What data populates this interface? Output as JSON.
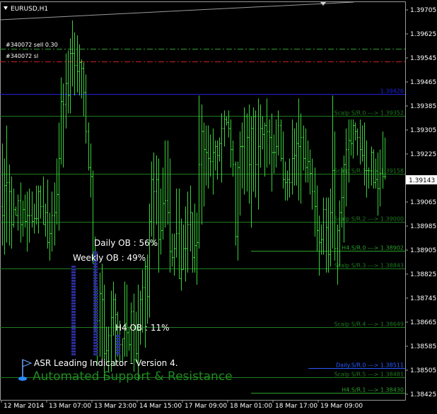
{
  "chart_data": {
    "type": "candlestick",
    "symbol_label": "EURUSD,H1",
    "y_ticks": [
      "1.39705",
      "1.39625",
      "1.39545",
      "1.39465",
      "1.39385",
      "1.39305",
      "1.39225",
      "1.39145",
      "1.39065",
      "1.38985",
      "1.38905",
      "1.38825",
      "1.38745",
      "1.38665",
      "1.38585",
      "1.38505",
      "1.38425"
    ],
    "y_range": [
      1.384,
      1.3974
    ],
    "x_ticks": [
      "12 Mar 2014",
      "13 Mar 07:00",
      "13 Mar 23:00",
      "14 Mar 15:00",
      "17 Mar 09:00",
      "18 Mar 01:00",
      "18 Mar 17:00",
      "19 Mar 09:00"
    ],
    "current_price": "1.39143",
    "levels": [
      {
        "label": "",
        "price": 1.39575,
        "color": "#2e9e2e",
        "style": "dashdot"
      },
      {
        "label": "",
        "price": 1.39534,
        "color": "#cc2222",
        "style": "dashdot"
      },
      {
        "label": "1.39426",
        "price": 1.39426,
        "color": "#1e22dd",
        "style": "solid"
      },
      {
        "label": "Scalp S/R.0 ---> 1.39352",
        "price": 1.39352,
        "color": "#1f7a1f",
        "style": "solid"
      },
      {
        "label": "Scalp S/R.1 ---> 1.39158",
        "price": 1.39158,
        "color": "#1f7a1f",
        "style": "solid"
      },
      {
        "label": "Scalp S/R.2 ---> 1.39000",
        "price": 1.39,
        "color": "#1f7a1f",
        "style": "solid"
      },
      {
        "label": "H4.S/R.0 ---> 1.38902",
        "price": 1.38902,
        "color": "#2aa02a",
        "style": "solid"
      },
      {
        "label": "Scalp S/R.3 ---> 1.38843",
        "price": 1.38843,
        "color": "#1f7a1f",
        "style": "solid"
      },
      {
        "label": "Scalp S/R.4 ---> 1.38649",
        "price": 1.38649,
        "color": "#1f7a1f",
        "style": "solid"
      },
      {
        "label": "Daily.S/R.0 ---> 1.38511",
        "price": 1.38511,
        "color": "#2a5bff",
        "style": "solid"
      },
      {
        "label": "Scalp S/R.5 ---> 1.38481",
        "price": 1.38481,
        "color": "#1f7a1f",
        "style": "solid"
      },
      {
        "label": "H4.S/R.1 ---> 1.38430",
        "price": 1.3843,
        "color": "#2aa02a",
        "style": "solid"
      }
    ],
    "orders": [
      "#340072 sell 0.30",
      "#340072 sl"
    ],
    "ob_labels": [
      {
        "text": "Daily OB : 56%",
        "value": 56
      },
      {
        "text": "Weekly OB : 49%",
        "value": 49
      },
      {
        "text": "H4 OB : 11%",
        "value": 11
      }
    ],
    "footer": {
      "line1": "ASR Leading Indicator - Version 4.",
      "line2": "Automated Support & Resistance"
    },
    "bars": [
      [
        1.3905,
        1.3926,
        1.3892,
        1.3902
      ],
      [
        1.3902,
        1.3921,
        1.3889,
        1.3912
      ],
      [
        1.3912,
        1.3932,
        1.3893,
        1.3913
      ],
      [
        1.3913,
        1.3919,
        1.3892,
        1.391
      ],
      [
        1.391,
        1.3915,
        1.3891,
        1.3899
      ],
      [
        1.3899,
        1.3911,
        1.3898,
        1.3904
      ],
      [
        1.3904,
        1.3905,
        1.3902,
        1.3902
      ],
      [
        1.3902,
        1.3909,
        1.3897,
        1.3907
      ],
      [
        1.3907,
        1.3913,
        1.3893,
        1.3899
      ],
      [
        1.3899,
        1.3907,
        1.3895,
        1.3904
      ],
      [
        1.3904,
        1.3909,
        1.3898,
        1.39
      ],
      [
        1.39,
        1.391,
        1.389,
        1.3902
      ],
      [
        1.3902,
        1.3911,
        1.3893,
        1.3902
      ],
      [
        1.3902,
        1.391,
        1.3898,
        1.39
      ],
      [
        1.39,
        1.3906,
        1.3896,
        1.3901
      ],
      [
        1.3901,
        1.3912,
        1.3899,
        1.3901
      ],
      [
        1.3901,
        1.3912,
        1.3896,
        1.391
      ],
      [
        1.391,
        1.3912,
        1.3901,
        1.3905
      ],
      [
        1.3905,
        1.3915,
        1.3899,
        1.3899
      ],
      [
        1.3899,
        1.3906,
        1.3895,
        1.3903
      ],
      [
        1.3903,
        1.3914,
        1.3891,
        1.3893
      ],
      [
        1.3893,
        1.3903,
        1.3887,
        1.3896
      ],
      [
        1.3896,
        1.391,
        1.389,
        1.3902
      ],
      [
        1.3902,
        1.3913,
        1.3892,
        1.3903
      ],
      [
        1.3903,
        1.3921,
        1.3899,
        1.3909
      ],
      [
        1.3909,
        1.3933,
        1.3897,
        1.3921
      ],
      [
        1.3921,
        1.3948,
        1.3919,
        1.394
      ],
      [
        1.394,
        1.3946,
        1.3918,
        1.3939
      ],
      [
        1.3939,
        1.3956,
        1.3931,
        1.3946
      ],
      [
        1.3946,
        1.3957,
        1.3936,
        1.3942
      ],
      [
        1.3942,
        1.3961,
        1.3936,
        1.3956
      ],
      [
        1.3956,
        1.3967,
        1.3945,
        1.3956
      ],
      [
        1.3956,
        1.3963,
        1.3942,
        1.3952
      ],
      [
        1.3952,
        1.3962,
        1.3943,
        1.395
      ],
      [
        1.395,
        1.3959,
        1.3942,
        1.3953
      ],
      [
        1.3953,
        1.3954,
        1.3941,
        1.3951
      ],
      [
        1.3951,
        1.3953,
        1.3935,
        1.3943
      ],
      [
        1.3943,
        1.3949,
        1.3926,
        1.393
      ],
      [
        1.393,
        1.3933,
        1.3917,
        1.3918
      ],
      [
        1.3918,
        1.3926,
        1.3908,
        1.3915
      ],
      [
        1.3915,
        1.3917,
        1.3886,
        1.3886
      ],
      [
        1.3886,
        1.3895,
        1.3863,
        1.387
      ],
      [
        1.387,
        1.3878,
        1.3852,
        1.3867
      ],
      [
        1.3867,
        1.3883,
        1.3855,
        1.3876
      ],
      [
        1.3876,
        1.3886,
        1.3854,
        1.3874
      ],
      [
        1.3874,
        1.3879,
        1.3847,
        1.3856
      ],
      [
        1.3856,
        1.3865,
        1.3852,
        1.3857
      ],
      [
        1.3857,
        1.3865,
        1.385,
        1.3862
      ],
      [
        1.3862,
        1.3877,
        1.385,
        1.3868
      ],
      [
        1.3868,
        1.388,
        1.3862,
        1.3874
      ],
      [
        1.3874,
        1.3876,
        1.3852,
        1.3869
      ],
      [
        1.3869,
        1.387,
        1.3855,
        1.386
      ],
      [
        1.386,
        1.3867,
        1.3853,
        1.3859
      ],
      [
        1.3859,
        1.3861,
        1.3853,
        1.3861
      ],
      [
        1.3861,
        1.388,
        1.3855,
        1.3866
      ],
      [
        1.3866,
        1.3879,
        1.3855,
        1.3863
      ],
      [
        1.3863,
        1.3865,
        1.3857,
        1.3859
      ],
      [
        1.3859,
        1.3873,
        1.3853,
        1.387
      ],
      [
        1.387,
        1.3876,
        1.385,
        1.3854
      ],
      [
        1.3854,
        1.387,
        1.3853,
        1.3856
      ],
      [
        1.3856,
        1.3879,
        1.3847,
        1.3864
      ],
      [
        1.3864,
        1.3877,
        1.3859,
        1.3874
      ],
      [
        1.3874,
        1.3884,
        1.3863,
        1.3878
      ],
      [
        1.3878,
        1.3887,
        1.3858,
        1.3885
      ],
      [
        1.3885,
        1.3889,
        1.3866,
        1.3875
      ],
      [
        1.3875,
        1.3906,
        1.3868,
        1.39
      ],
      [
        1.39,
        1.392,
        1.3895,
        1.3914
      ],
      [
        1.3914,
        1.3923,
        1.3892,
        1.391
      ],
      [
        1.391,
        1.3922,
        1.3899,
        1.3914
      ],
      [
        1.3914,
        1.3921,
        1.3883,
        1.3894
      ],
      [
        1.3894,
        1.3911,
        1.3889,
        1.3897
      ],
      [
        1.3897,
        1.3918,
        1.3894,
        1.3906
      ],
      [
        1.3906,
        1.3927,
        1.3898,
        1.3907
      ],
      [
        1.3907,
        1.3927,
        1.3899,
        1.3903
      ],
      [
        1.3903,
        1.3921,
        1.3883,
        1.389
      ],
      [
        1.389,
        1.3896,
        1.3885,
        1.3888
      ],
      [
        1.3888,
        1.3896,
        1.3882,
        1.3891
      ],
      [
        1.3891,
        1.3911,
        1.3888,
        1.3896
      ],
      [
        1.3896,
        1.3911,
        1.3881,
        1.3881
      ],
      [
        1.3881,
        1.3901,
        1.3877,
        1.3884
      ],
      [
        1.3884,
        1.3899,
        1.3884,
        1.3891
      ],
      [
        1.3891,
        1.3905,
        1.388,
        1.3891
      ],
      [
        1.3891,
        1.391,
        1.3883,
        1.3899
      ],
      [
        1.3899,
        1.3912,
        1.389,
        1.3903
      ],
      [
        1.3903,
        1.3903,
        1.3883,
        1.3888
      ],
      [
        1.3888,
        1.3906,
        1.3883,
        1.3892
      ],
      [
        1.3892,
        1.3903,
        1.3879,
        1.3893
      ],
      [
        1.3893,
        1.3942,
        1.3891,
        1.3919
      ],
      [
        1.3919,
        1.3939,
        1.3899,
        1.393
      ],
      [
        1.393,
        1.3933,
        1.3905,
        1.3924
      ],
      [
        1.3924,
        1.3932,
        1.3912,
        1.3923
      ],
      [
        1.3923,
        1.3932,
        1.3911,
        1.3921
      ],
      [
        1.3921,
        1.3929,
        1.3915,
        1.392
      ],
      [
        1.392,
        1.3931,
        1.3909,
        1.3923
      ],
      [
        1.3923,
        1.3927,
        1.3917,
        1.3925
      ],
      [
        1.3925,
        1.3927,
        1.3914,
        1.3922
      ],
      [
        1.3922,
        1.3928,
        1.392,
        1.3926
      ],
      [
        1.3926,
        1.3936,
        1.3913,
        1.3931
      ],
      [
        1.3931,
        1.3937,
        1.3925,
        1.3934
      ],
      [
        1.3934,
        1.3935,
        1.3932,
        1.3933
      ],
      [
        1.3933,
        1.3937,
        1.3928,
        1.3931
      ],
      [
        1.3931,
        1.3934,
        1.3918,
        1.3924
      ],
      [
        1.3924,
        1.3927,
        1.3915,
        1.3919
      ],
      [
        1.3919,
        1.392,
        1.3892,
        1.3895
      ],
      [
        1.3895,
        1.392,
        1.3887,
        1.3918
      ],
      [
        1.3918,
        1.393,
        1.3902,
        1.3925
      ],
      [
        1.3925,
        1.3933,
        1.3911,
        1.3925
      ],
      [
        1.3925,
        1.3938,
        1.3909,
        1.3935
      ],
      [
        1.3935,
        1.3936,
        1.391,
        1.3928
      ],
      [
        1.3928,
        1.3939,
        1.3906,
        1.3919
      ],
      [
        1.3919,
        1.3935,
        1.3898,
        1.3931
      ],
      [
        1.3931,
        1.3938,
        1.391,
        1.3935
      ],
      [
        1.3935,
        1.3937,
        1.3908,
        1.3919
      ],
      [
        1.3919,
        1.3941,
        1.3904,
        1.3925
      ],
      [
        1.3925,
        1.3939,
        1.3918,
        1.3931
      ],
      [
        1.3931,
        1.3935,
        1.3924,
        1.3929
      ],
      [
        1.3929,
        1.3933,
        1.3915,
        1.3932
      ],
      [
        1.3932,
        1.3941,
        1.3918,
        1.393
      ],
      [
        1.393,
        1.3934,
        1.3919,
        1.3928
      ],
      [
        1.3928,
        1.3936,
        1.391,
        1.3923
      ],
      [
        1.3923,
        1.3929,
        1.3916,
        1.3923
      ],
      [
        1.3923,
        1.3934,
        1.3918,
        1.3925
      ],
      [
        1.3925,
        1.3937,
        1.3922,
        1.3932
      ],
      [
        1.3932,
        1.3934,
        1.392,
        1.3921
      ],
      [
        1.3921,
        1.393,
        1.3911,
        1.3914
      ],
      [
        1.3914,
        1.392,
        1.3907,
        1.3913
      ],
      [
        1.3913,
        1.3917,
        1.3907,
        1.3914
      ],
      [
        1.3914,
        1.3921,
        1.3908,
        1.3913
      ],
      [
        1.3913,
        1.3934,
        1.3909,
        1.3921
      ],
      [
        1.3921,
        1.3931,
        1.3912,
        1.3922
      ],
      [
        1.3922,
        1.3933,
        1.3912,
        1.3926
      ],
      [
        1.3926,
        1.3941,
        1.3907,
        1.3925
      ],
      [
        1.3925,
        1.3936,
        1.3906,
        1.3928
      ],
      [
        1.3928,
        1.3932,
        1.3917,
        1.3921
      ],
      [
        1.3921,
        1.3931,
        1.3913,
        1.3918
      ],
      [
        1.3918,
        1.3927,
        1.3913,
        1.392
      ],
      [
        1.392,
        1.3924,
        1.3909,
        1.3916
      ],
      [
        1.3916,
        1.3921,
        1.3904,
        1.391
      ],
      [
        1.391,
        1.3918,
        1.3895,
        1.3905
      ],
      [
        1.3905,
        1.3912,
        1.389,
        1.3897
      ],
      [
        1.3897,
        1.3902,
        1.3882,
        1.3893
      ],
      [
        1.3893,
        1.3899,
        1.3889,
        1.3894
      ],
      [
        1.3894,
        1.3908,
        1.3889,
        1.3904
      ],
      [
        1.3904,
        1.3908,
        1.3883,
        1.3898
      ],
      [
        1.3898,
        1.3908,
        1.3883,
        1.3889
      ],
      [
        1.3889,
        1.3911,
        1.3885,
        1.3903
      ],
      [
        1.3903,
        1.3942,
        1.3891,
        1.3917
      ],
      [
        1.3917,
        1.393,
        1.3887,
        1.3891
      ],
      [
        1.3891,
        1.3899,
        1.3879,
        1.3897
      ],
      [
        1.3897,
        1.3907,
        1.3885,
        1.3903
      ],
      [
        1.3903,
        1.3918,
        1.3898,
        1.3908
      ],
      [
        1.3908,
        1.3922,
        1.3893,
        1.3919
      ],
      [
        1.3919,
        1.3931,
        1.3905,
        1.3924
      ],
      [
        1.3924,
        1.3934,
        1.3913,
        1.3927
      ],
      [
        1.3927,
        1.3934,
        1.3922,
        1.3926
      ],
      [
        1.3926,
        1.3934,
        1.3921,
        1.3932
      ],
      [
        1.3932,
        1.3933,
        1.3927,
        1.393
      ],
      [
        1.393,
        1.3931,
        1.3922,
        1.3928
      ],
      [
        1.3928,
        1.3934,
        1.3919,
        1.3924
      ],
      [
        1.3924,
        1.3932,
        1.392,
        1.3922
      ],
      [
        1.3922,
        1.3933,
        1.3912,
        1.3917
      ],
      [
        1.3917,
        1.3927,
        1.3908,
        1.3917
      ],
      [
        1.3917,
        1.3918,
        1.3911,
        1.3917
      ],
      [
        1.3917,
        1.3925,
        1.3912,
        1.3923
      ],
      [
        1.3923,
        1.3924,
        1.3911,
        1.3913
      ],
      [
        1.3913,
        1.3921,
        1.3911,
        1.3914
      ],
      [
        1.3914,
        1.3923,
        1.3902,
        1.3911
      ],
      [
        1.3911,
        1.3924,
        1.3905,
        1.3916
      ],
      [
        1.3916,
        1.393,
        1.3911,
        1.3915
      ],
      [
        1.3915,
        1.3928,
        1.3914,
        1.3915
      ]
    ]
  }
}
